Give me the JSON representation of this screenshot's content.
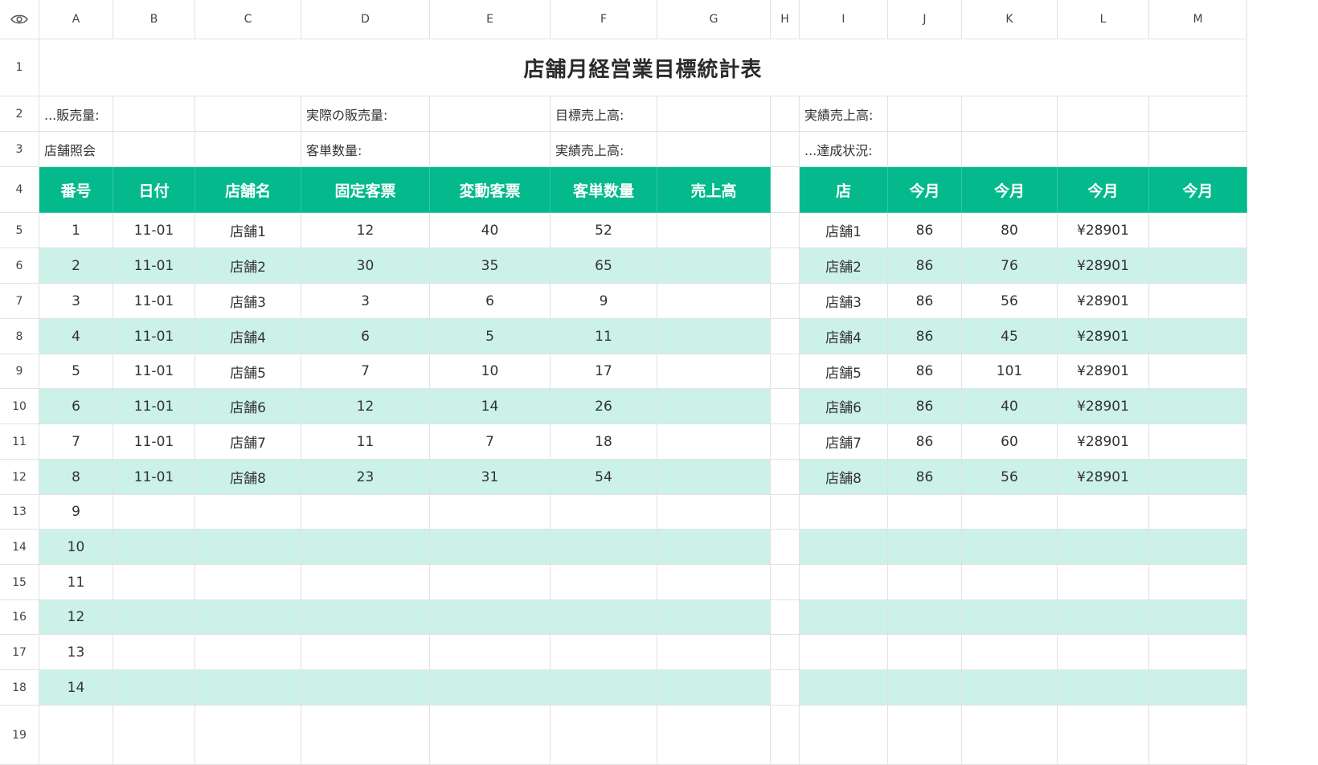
{
  "colors": {
    "header_bg": "#04b98c",
    "stripe_bg": "#ccf1e8",
    "grid_line": "#e2e2e2"
  },
  "toolbar": {
    "corner_icon": "eye-icon"
  },
  "columns": [
    "A",
    "B",
    "C",
    "D",
    "E",
    "F",
    "G",
    "H",
    "I",
    "J",
    "K",
    "L",
    "M"
  ],
  "rows": [
    "1",
    "2",
    "3",
    "4",
    "5",
    "6",
    "7",
    "8",
    "9",
    "10",
    "11",
    "12",
    "13",
    "14",
    "15",
    "16",
    "17",
    "18",
    "19"
  ],
  "title": "店舗月経営業目標統計表",
  "info": {
    "sales_volume_label": "...販売量:",
    "actual_sales_volume_label": "実際の販売量:",
    "target_sales_label": "目標売上高:",
    "actual_sales_label": "実績売上高:",
    "store_query_label": "店舗照会",
    "unit_volume_label": "客単数量:",
    "actual_sales_label_2": "実績売上高:",
    "achievement_label": "...達成状況:"
  },
  "main_table": {
    "headers": [
      "番号",
      "日付",
      "店舗名",
      "固定客票",
      "変動客票",
      "客単数量",
      "売上高"
    ],
    "rows": [
      [
        "1",
        "11-01",
        "店舗1",
        "12",
        "40",
        "52",
        ""
      ],
      [
        "2",
        "11-01",
        "店舗2",
        "30",
        "35",
        "65",
        ""
      ],
      [
        "3",
        "11-01",
        "店舗3",
        "3",
        "6",
        "9",
        ""
      ],
      [
        "4",
        "11-01",
        "店舗4",
        "6",
        "5",
        "11",
        ""
      ],
      [
        "5",
        "11-01",
        "店舗5",
        "7",
        "10",
        "17",
        ""
      ],
      [
        "6",
        "11-01",
        "店舗6",
        "12",
        "14",
        "26",
        ""
      ],
      [
        "7",
        "11-01",
        "店舗7",
        "11",
        "7",
        "18",
        ""
      ],
      [
        "8",
        "11-01",
        "店舗8",
        "23",
        "31",
        "54",
        ""
      ],
      [
        "9",
        "",
        "",
        "",
        "",
        "",
        ""
      ],
      [
        "10",
        "",
        "",
        "",
        "",
        "",
        ""
      ],
      [
        "11",
        "",
        "",
        "",
        "",
        "",
        ""
      ],
      [
        "12",
        "",
        "",
        "",
        "",
        "",
        ""
      ],
      [
        "13",
        "",
        "",
        "",
        "",
        "",
        ""
      ],
      [
        "14",
        "",
        "",
        "",
        "",
        "",
        ""
      ]
    ]
  },
  "side_table": {
    "headers": [
      "店",
      "今月",
      "今月",
      "今月",
      "今月"
    ],
    "rows": [
      [
        "店舗1",
        "86",
        "80",
        "¥28901",
        ""
      ],
      [
        "店舗2",
        "86",
        "76",
        "¥28901",
        ""
      ],
      [
        "店舗3",
        "86",
        "56",
        "¥28901",
        ""
      ],
      [
        "店舗4",
        "86",
        "45",
        "¥28901",
        ""
      ],
      [
        "店舗5",
        "86",
        "101",
        "¥28901",
        ""
      ],
      [
        "店舗6",
        "86",
        "40",
        "¥28901",
        ""
      ],
      [
        "店舗7",
        "86",
        "60",
        "¥28901",
        ""
      ],
      [
        "店舗8",
        "86",
        "56",
        "¥28901",
        ""
      ],
      [
        "",
        "",
        "",
        "",
        ""
      ],
      [
        "",
        "",
        "",
        "",
        ""
      ],
      [
        "",
        "",
        "",
        "",
        ""
      ],
      [
        "",
        "",
        "",
        "",
        ""
      ],
      [
        "",
        "",
        "",
        "",
        ""
      ],
      [
        "",
        "",
        "",
        "",
        ""
      ]
    ]
  }
}
